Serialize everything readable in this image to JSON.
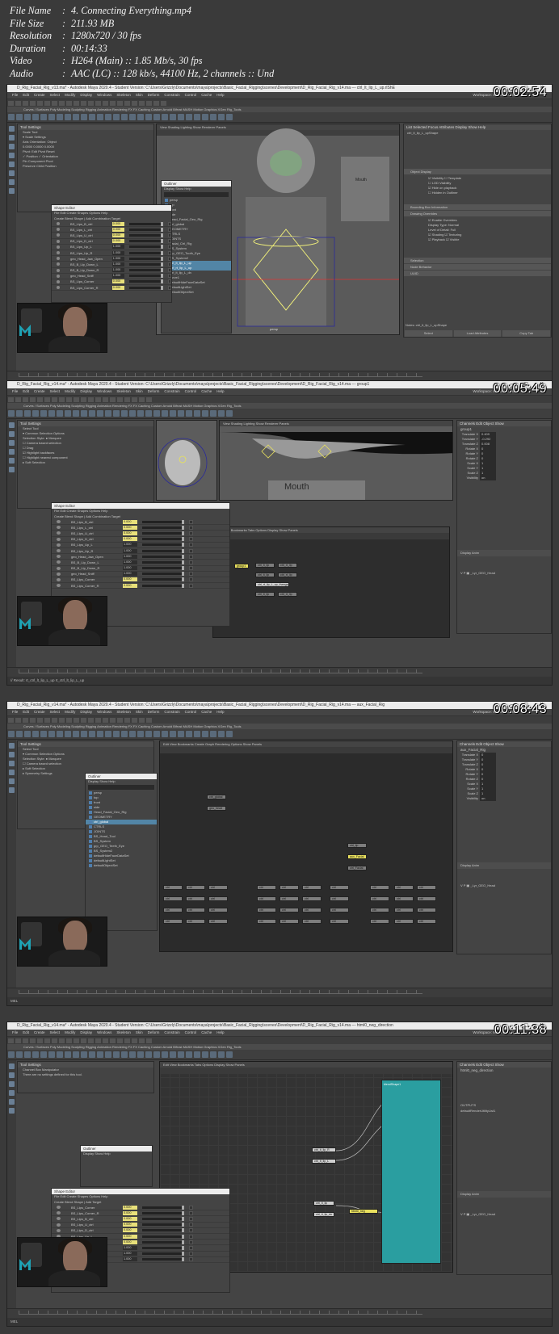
{
  "info": {
    "file_name": {
      "label": "File Name",
      "value": "4. Connecting Everything.mp4"
    },
    "file_size": {
      "label": "File Size",
      "value": "211.93 MB"
    },
    "resolution": {
      "label": "Resolution",
      "value": "1280x720 / 30 fps"
    },
    "duration": {
      "label": "Duration",
      "value": "00:14:33"
    },
    "video": {
      "label": "Video",
      "value": "H264 (Main) :: 1.85 Mb/s, 30 fps"
    },
    "audio": {
      "label": "Audio",
      "value": "AAC (LC) :: 128 kb/s, 44100 Hz, 2 channels :: Und"
    }
  },
  "menu": [
    "File",
    "Edit",
    "Create",
    "Select",
    "Modify",
    "Display",
    "Windows",
    "Skeleton",
    "Skin",
    "Deform",
    "Constrain",
    "Control",
    "Cache",
    "Help"
  ],
  "shelf_tabs": "Curves / Surfaces   Poly Modeling   Sculpting   Rigging   Animation   Rendering   FX   FX Caching   Custom   Arnold   Bifrost   MASH   Motion Graphics   XGen   Rig_Tools",
  "workspace": "Workspace: Maya Classic",
  "frames": [
    {
      "timestamp": "00:02:54",
      "title": "D_Rig_Facial_Rig_v13.ma* - Autodesk Maya 2020.4 - Student Version: C:\\Users\\Grizzly\\Documents\\maya\\projects\\Basic_Facial_Rigging\\scenes\\Development\\D_Rig_Facial_Rig_v14.ma  ---  ctrl_lt_lip_L_up.rlShE",
      "outliner_title": "Outliner",
      "blend_title": "Shape Editor",
      "attr_panel": {
        "tabs": "List   Selected   Focus   Attributes   Display   Show   Help",
        "node": "ctrl_lt_lip_L_upShape",
        "sections": [
          "Object Display",
          "Bounding Box Information",
          "Drawing Overrides",
          "Selection",
          "Node Behavior",
          "UUID"
        ],
        "buttons": [
          "Select",
          "Load Attributes",
          "Copy Tab"
        ],
        "notes": "Notes: ctrl_lt_lip_L_upShape"
      },
      "outliner_items": [
        "persp",
        "top",
        "front",
        "side",
        "Head_Facial_Geo_Rig",
        "ctrl_global",
        "GEOMETRY",
        "CTRLS",
        "JOINTS",
        "Facial_Ctrl_Rig",
        "BS_System",
        "grp_GEO_Tooth_Eye",
        "BS_System2",
        "ctrl_lt_lip_L_up",
        "ctrl_rt_lip_L_up",
        "ctrl_lt_lip_L_dn",
        "curve1",
        "defaultHideFaceDataSet",
        "defaultLightSet",
        "defaultObjectSet"
      ],
      "blend_rows": [
        {
          "name": "BS_Lips_B_ctrl",
          "w": "0.000"
        },
        {
          "name": "BS_Lips_L_ctrl",
          "w": "0.000"
        },
        {
          "name": "BS_Lips_U_ctrl",
          "w": "0.000"
        },
        {
          "name": "BS_Lips_D_ctrl",
          "w": "0.000"
        },
        {
          "name": "BS_Lips_Up_L",
          "w": "1.000"
        },
        {
          "name": "BS_Lips_Up_R",
          "w": "1.000"
        },
        {
          "name": "geo_Head_Jaw_Open",
          "w": "1.000"
        },
        {
          "name": "BS_B_Lip_Down_L",
          "w": "1.000"
        },
        {
          "name": "BS_B_Lip_Down_R",
          "w": "1.000"
        },
        {
          "name": "geo_Head_Sniff",
          "w": "1.000"
        },
        {
          "name": "BS_Lips_Corner",
          "w": "0.000"
        },
        {
          "name": "BS_Lips_Corner_R",
          "w": "0.000"
        }
      ],
      "viewport_label": "persp",
      "mouth_label": "Mouth",
      "status": "MEL"
    },
    {
      "timestamp": "00:05:49",
      "title": "D_Rig_Facial_Rig_v14.ma* - Autodesk Maya 2020.4 - Student Version: C:\\Users\\Grizzly\\Documents\\maya\\projects\\Basic_Facial_Rigging\\scenes\\Development\\D_Rig_Facial_Rig_v14.ma  ---  group1",
      "blend_title": "Shape Editor",
      "mouth_label": "Mouth",
      "channel_node": "group1",
      "channels": [
        {
          "k": "Translate X",
          "v": "0.409"
        },
        {
          "k": "Translate Y",
          "v": "-0.292"
        },
        {
          "k": "Translate Z",
          "v": "0.008"
        },
        {
          "k": "Rotate X",
          "v": "0"
        },
        {
          "k": "Rotate Y",
          "v": "0"
        },
        {
          "k": "Rotate Z",
          "v": "0"
        },
        {
          "k": "Scale X",
          "v": "1"
        },
        {
          "k": "Scale Y",
          "v": "1"
        },
        {
          "k": "Scale Z",
          "v": "1"
        },
        {
          "k": "Visibility",
          "v": "on"
        }
      ],
      "layer": "_Lyr_GEO_Head",
      "tooltip": "ctrl_rt_lip_L_up_thangs/Shape",
      "blend_rows": [
        {
          "name": "BS_Lips_B_ctrl",
          "w": "0.000"
        },
        {
          "name": "BS_Lips_L_ctrl",
          "w": "0.000"
        },
        {
          "name": "BS_Lips_U_ctrl",
          "w": "0.000"
        },
        {
          "name": "BS_Lips_D_ctrl",
          "w": "0.000"
        },
        {
          "name": "BS_Lips_Up_L",
          "w": "1.000"
        },
        {
          "name": "BS_Lips_Up_R",
          "w": "1.000"
        },
        {
          "name": "geo_Head_Jaw_Open",
          "w": "1.000"
        },
        {
          "name": "BS_B_Lip_Down_L",
          "w": "1.000"
        },
        {
          "name": "BS_B_Lip_Down_R",
          "w": "1.000"
        },
        {
          "name": "geo_Head_Sniff",
          "w": "1.000"
        },
        {
          "name": "BS_Lips_Corner",
          "w": "0.000"
        },
        {
          "name": "BS_Lips_Corner_R",
          "w": "0.000"
        }
      ],
      "status": "// Result: rt_ctrl_lt_lip_L_up rt_ctrl_lt_lip_L_up"
    },
    {
      "timestamp": "00:08:43",
      "title": "D_Rig_Facial_Rig_v14.ma* - Autodesk Maya 2020.4 - Student Version: C:\\Users\\Grizzly\\Documents\\maya\\projects\\Basic_Facial_Rigging\\scenes\\Development\\D_Rig_Facial_Rig_v14.ma  ---  aux_Facial_Rig",
      "outliner_title": "Outliner",
      "channel_node": "aux_Facial_Rig",
      "channels": [
        {
          "k": "Translate X",
          "v": "0"
        },
        {
          "k": "Translate Y",
          "v": "0"
        },
        {
          "k": "Translate Z",
          "v": "0"
        },
        {
          "k": "Rotate X",
          "v": "0"
        },
        {
          "k": "Rotate Y",
          "v": "0"
        },
        {
          "k": "Rotate Z",
          "v": "0"
        },
        {
          "k": "Scale X",
          "v": "1"
        },
        {
          "k": "Scale Y",
          "v": "1"
        },
        {
          "k": "Scale Z",
          "v": "1"
        },
        {
          "k": "Visibility",
          "v": "on"
        }
      ],
      "layer": "_Lyr_GEO_Head",
      "outliner_items": [
        "persp",
        "top",
        "front",
        "side",
        "Head_Facial_Geo_Rig",
        "GEOMETRY",
        "ctrl_global",
        "CTRLS",
        "JOINTS",
        "BS_Head_Tool",
        "BS_System",
        "grp_GEO_Teeth_Eye",
        "BS_System2",
        "defaultHideFaceDataSet",
        "defaultLightSet",
        "defaultObjectSet"
      ],
      "status": "MEL"
    },
    {
      "timestamp": "00:11:38",
      "title": "D_Rig_Facial_Rig_v14.ma* - Autodesk Maya 2020.4 - Student Version: C:\\Users\\Grizzly\\Documents\\maya\\projects\\Basic_Facial_Rigging\\scenes\\Development\\D_Rig_Facial_Rig_v14.ma  ---  html0_neg_direction",
      "blend_title": "Shape Editor",
      "outliner_title": "Outliner",
      "channel_node": "html0_neg_direction",
      "outputs_label": "OUTPUTS",
      "outputs_value": "defaultRenderUtilityList1",
      "layer": "_Lyr_GEO_Head",
      "blend_rows": [
        {
          "name": "BS_Lips_Corner",
          "w": "0.000"
        },
        {
          "name": "BS_Lips_Corner_R",
          "w": "0.000"
        },
        {
          "name": "BS_Lips_B_ctrl",
          "w": "0.000"
        },
        {
          "name": "BS_Lips_U_ctrl",
          "w": "0.000"
        },
        {
          "name": "BS_Lips_D_ctrl",
          "w": "0.000"
        },
        {
          "name": "BS_Lips_Up_L",
          "w": "0.000"
        },
        {
          "name": "BS_Lips_Up_R",
          "w": "0.000"
        },
        {
          "name": "geo_Head_Jaw",
          "w": "1.000"
        },
        {
          "name": "geo_Head_Smile",
          "w": "1.000"
        },
        {
          "name": "BS_B_Lip_Down",
          "w": "1.000"
        }
      ],
      "status": "MEL"
    }
  ]
}
